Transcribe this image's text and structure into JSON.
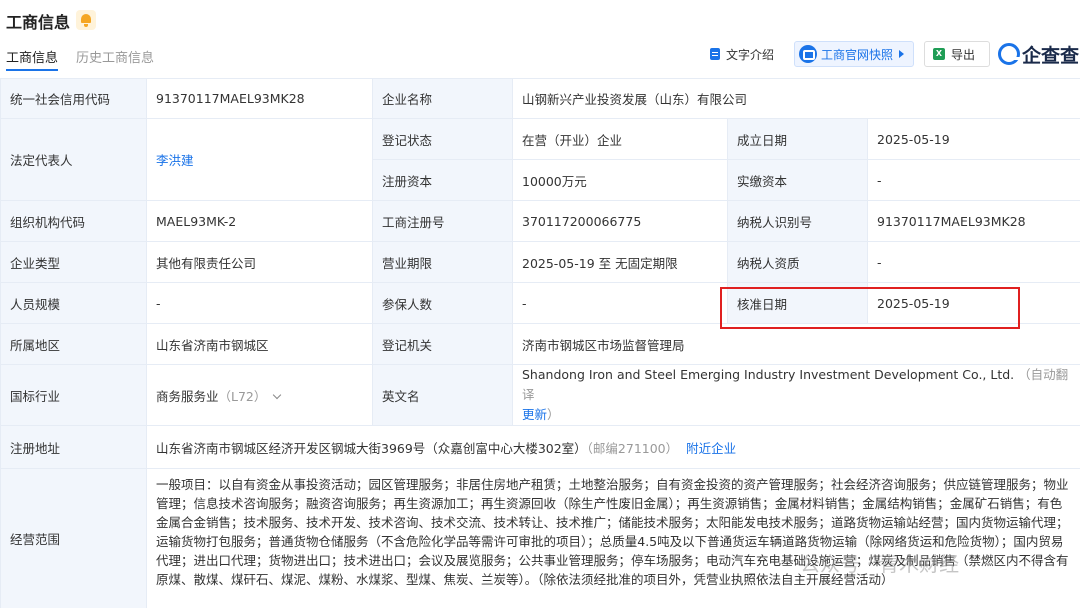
{
  "header": {
    "title": "工商信息",
    "tabs": [
      {
        "label": "工商信息",
        "active": true
      },
      {
        "label": "历史工商信息",
        "active": false
      }
    ],
    "toolbar": {
      "text_intro": "文字介绍",
      "snapshot": "工商官网快照",
      "export": "导出",
      "brand": "企查查"
    }
  },
  "table": {
    "credit_code_label": "统一社会信用代码",
    "credit_code": "91370117MAEL93MK28",
    "company_name_label": "企业名称",
    "company_name": "山钢新兴产业投资发展（山东）有限公司",
    "legal_rep_label": "法定代表人",
    "legal_rep": "李洪建",
    "reg_status_label": "登记状态",
    "reg_status": "在营（开业）企业",
    "est_date_label": "成立日期",
    "est_date": "2025-05-19",
    "reg_capital_label": "注册资本",
    "reg_capital": "10000万元",
    "paid_capital_label": "实缴资本",
    "paid_capital": "-",
    "org_code_label": "组织机构代码",
    "org_code": "MAEL93MK-2",
    "reg_no_label": "工商注册号",
    "reg_no": "370117200066775",
    "taxpayer_id_label": "纳税人识别号",
    "taxpayer_id": "91370117MAEL93MK28",
    "company_type_label": "企业类型",
    "company_type": "其他有限责任公司",
    "biz_term_label": "营业期限",
    "biz_term": "2025-05-19 至 无固定期限",
    "taxpayer_qual_label": "纳税人资质",
    "taxpayer_qual": "-",
    "staff_size_label": "人员规模",
    "staff_size": "-",
    "insured_label": "参保人数",
    "insured": "-",
    "approve_date_label": "核准日期",
    "approve_date": "2025-05-19",
    "region_label": "所属地区",
    "region": "山东省济南市钢城区",
    "reg_authority_label": "登记机关",
    "reg_authority": "济南市钢城区市场监督管理局",
    "industry_label": "国标行业",
    "industry": "商务服务业",
    "industry_code": "（L72）",
    "english_name_label": "英文名",
    "english_name": "Shandong Iron and Steel Emerging Industry Investment Development Co., Ltd.",
    "auto_translate": "（自动翻译",
    "update": "更新",
    "close_paren": "）",
    "address_label": "注册地址",
    "address": "山东省济南市钢城区经济开发区钢城大街3969号（众嘉创富中心大楼302室）",
    "postcode": "（邮编271100）",
    "nearby": "附近企业",
    "scope_label": "经营范围",
    "scope": "一般项目：以自有资金从事投资活动；园区管理服务；非居住房地产租赁；土地整治服务；自有资金投资的资产管理服务；社会经济咨询服务；供应链管理服务；物业管理；信息技术咨询服务；融资咨询服务；再生资源加工；再生资源回收（除生产性废旧金属）；再生资源销售；金属材料销售；金属结构销售；金属矿石销售；有色金属合金销售；技术服务、技术开发、技术咨询、技术交流、技术转让、技术推广；储能技术服务；太阳能发电技术服务；道路货物运输站经营；国内货物运输代理；运输货物打包服务；普通货物仓储服务（不含危险化学品等需许可审批的项目）；总质量4.5吨及以下普通货运车辆道路货物运输（除网络货运和危险货物）；国内贸易代理；进出口代理；货物进出口；技术进出口；会议及展览服务；公共事业管理服务；停车场服务；电动汽车充电基础设施运营；煤炭及制品销售（禁燃区内不得含有原煤、散煤、煤矸石、煤泥、煤粉、水煤浆、型煤、焦炭、兰炭等）。（除依法须经批准的项目外，凭营业执照依法自主开展经营活动）"
  },
  "watermark": "公众号 · 青木财经",
  "colors": {
    "accent": "#1a73e8",
    "label_bg": "#f2f6fc",
    "highlight": "#e02020"
  }
}
